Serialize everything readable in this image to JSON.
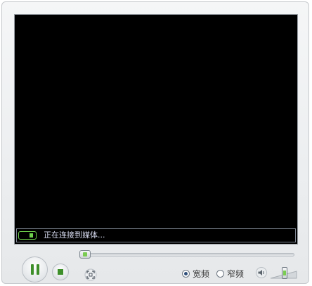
{
  "status": {
    "text": "正在连接到媒体..."
  },
  "playback": {
    "progress_fraction": 0.0,
    "volume_fraction": 0.55
  },
  "aspect_options": [
    {
      "label": "宽频",
      "selected": true
    },
    {
      "label": "窄频",
      "selected": false
    }
  ],
  "icons": {
    "pause": "pause-icon",
    "stop": "stop-icon",
    "fullscreen": "fullscreen-icon",
    "volume": "volume-icon",
    "signal": "signal-icon"
  },
  "colors": {
    "accent_green": "#3e8f2a",
    "screen": "#000000",
    "status_text": "#d9ddf2"
  }
}
